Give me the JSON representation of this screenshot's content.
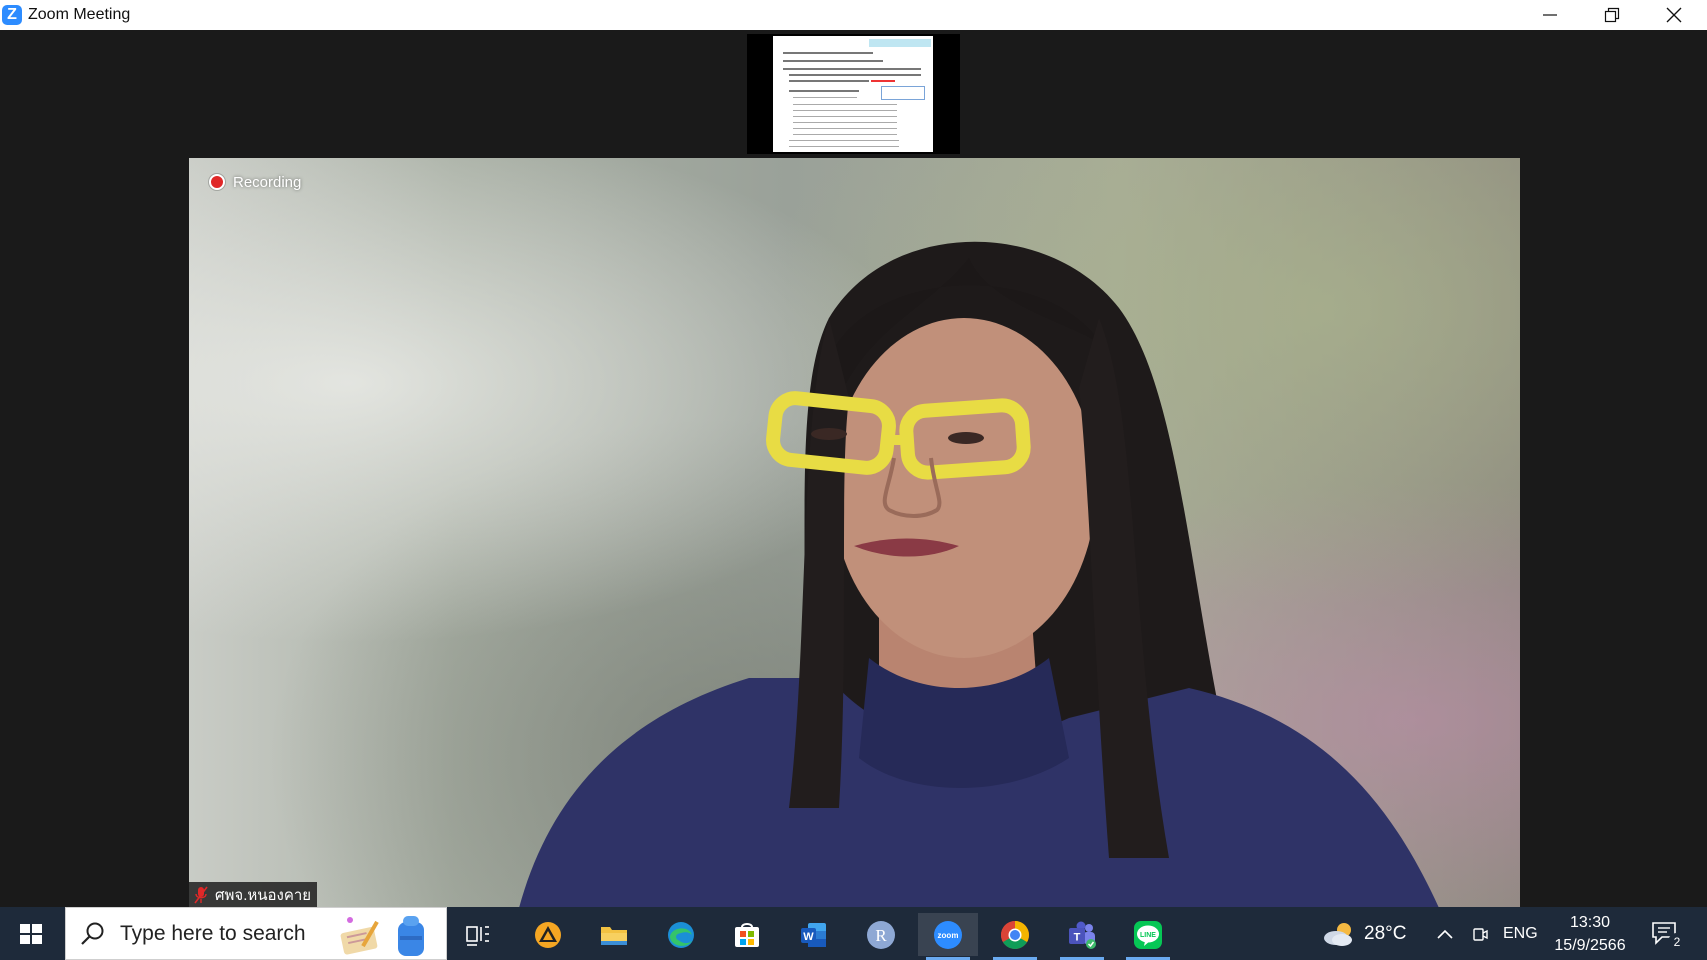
{
  "window": {
    "title": "Zoom Meeting",
    "logo_letter": "Z"
  },
  "meeting": {
    "recording_label": "Recording",
    "participant_name": "ศพจ.หนองคาย"
  },
  "taskbar": {
    "search_placeholder": "Type here to search",
    "apps": [
      {
        "name": "Task View",
        "icon": "task-view-icon"
      },
      {
        "name": "Vectr/VLC-like app",
        "icon": "triangle-app-icon"
      },
      {
        "name": "File Explorer",
        "icon": "folder-icon"
      },
      {
        "name": "Microsoft Edge",
        "icon": "edge-icon"
      },
      {
        "name": "Microsoft Store",
        "icon": "store-icon"
      },
      {
        "name": "Microsoft Word",
        "icon": "word-icon"
      },
      {
        "name": "R",
        "icon": "r-icon"
      },
      {
        "name": "Zoom",
        "icon": "zoom-icon",
        "active": true
      },
      {
        "name": "Google Chrome",
        "icon": "chrome-icon"
      },
      {
        "name": "Microsoft Teams",
        "icon": "teams-icon"
      },
      {
        "name": "LINE",
        "icon": "line-icon"
      }
    ],
    "zoom_label": "zoom",
    "word_letter": "W",
    "r_letter": "R",
    "teams_letter": "T",
    "line_label": "LINE"
  },
  "tray": {
    "temperature": "28°C",
    "language": "ENG",
    "time": "13:30",
    "date": "15/9/2566",
    "notification_count": "2"
  },
  "colors": {
    "zoom_blue": "#2d8cff",
    "recording_red": "#e02828",
    "taskbar_bg": "#1e2a3a"
  }
}
